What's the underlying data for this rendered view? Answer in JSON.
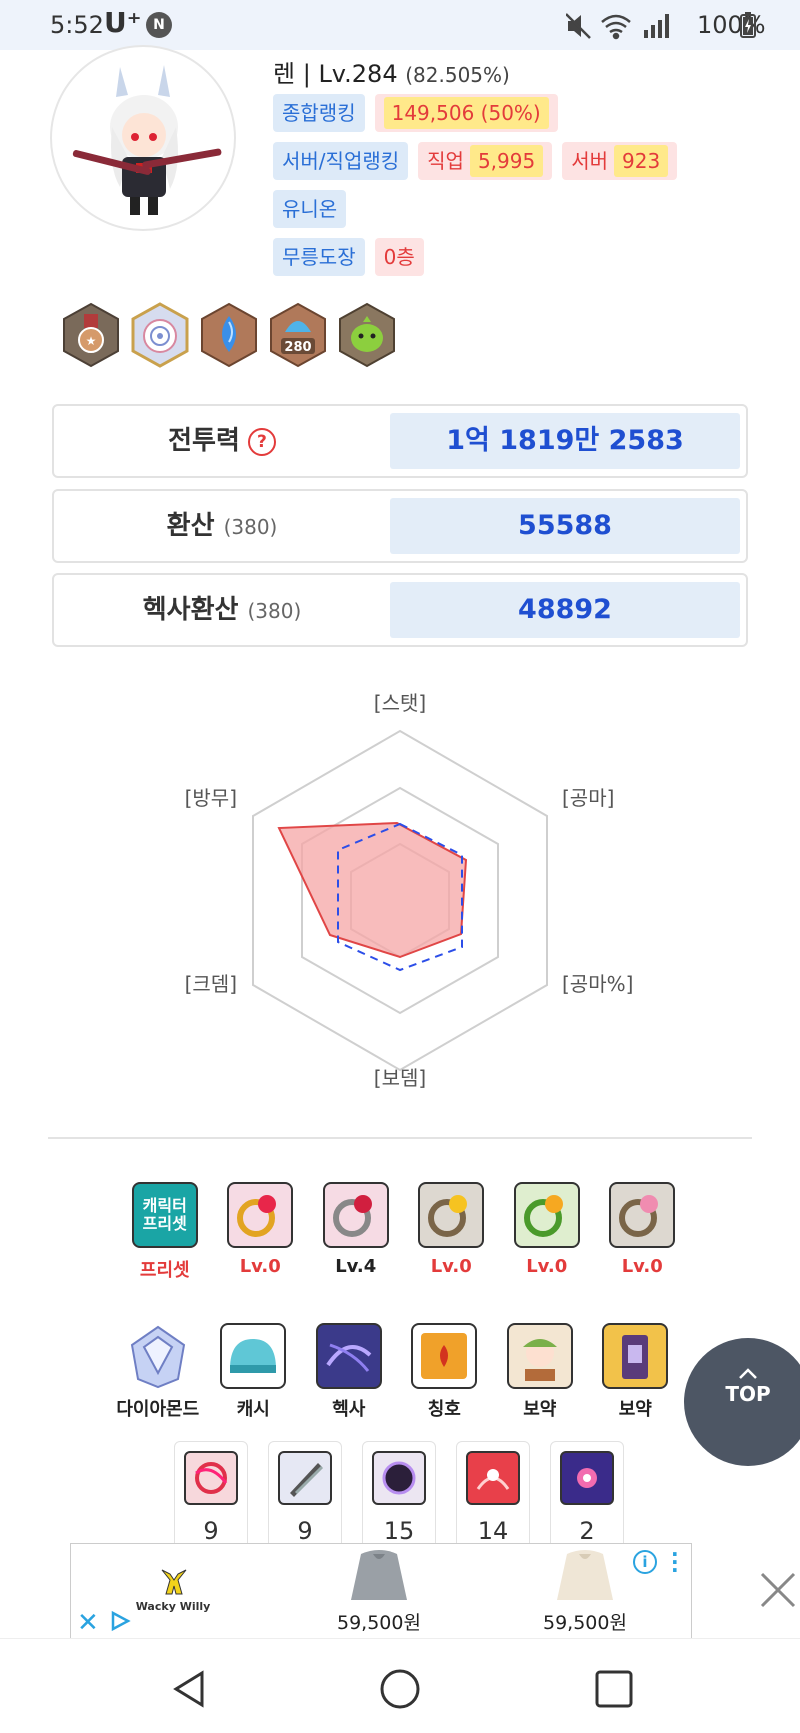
{
  "status_bar": {
    "time": "5:52",
    "carrier": "U⁺",
    "notif_badge": "N",
    "battery": "100%",
    "icons": [
      "mute-icon",
      "wifi-icon",
      "signal-icon",
      "battery-icon"
    ]
  },
  "profile": {
    "name": "렌",
    "separator": " | ",
    "level": "Lv.284",
    "exp": "(82.505%)",
    "overall_rank_label": "종합랭킹",
    "overall_rank_value": "149,506 (50%)",
    "server_job_rank_label": "서버/직업랭킹",
    "job_label": "직업",
    "job_value": "5,995",
    "server_label": "서버",
    "server_value": "923",
    "union_label": "유니온",
    "dojo_label": "무릉도장",
    "dojo_value": "0층"
  },
  "badges": [
    {
      "name": "bronze-medal-badge"
    },
    {
      "name": "target-badge"
    },
    {
      "name": "blue-gem-badge"
    },
    {
      "name": "280-badge",
      "text": "280"
    },
    {
      "name": "green-slime-badge"
    }
  ],
  "power": {
    "combat_label": "전투력",
    "combat_help": "?",
    "combat_value": "1억 1819만 2583",
    "conv_label": "환산",
    "conv_sub": "(380)",
    "conv_value": "55588",
    "hexa_label": "헥사환산",
    "hexa_sub": "(380)",
    "hexa_value": "48892"
  },
  "radar": {
    "axes": [
      "[스탯]",
      "[공마]",
      "[공마%]",
      "[보뎀]",
      "[크뎀]",
      "[방무]"
    ],
    "fill_color": "#f5a6a6",
    "line_color": "#e04646",
    "dash_color": "#2c4ee8"
  },
  "equip_row": [
    {
      "name": "character-preset",
      "label": "프리셋",
      "icon_text": "캐릭터 프리셋",
      "red": true
    },
    {
      "name": "ring-1",
      "label": "Lv.0",
      "red": true
    },
    {
      "name": "ring-2",
      "label": "Lv.4",
      "red": false
    },
    {
      "name": "ring-3",
      "label": "Lv.0",
      "red": true
    },
    {
      "name": "ring-4",
      "label": "Lv.0",
      "red": true
    },
    {
      "name": "ring-5",
      "label": "Lv.0",
      "red": true
    }
  ],
  "category_row": [
    {
      "name": "diamond",
      "label": "다이아몬드"
    },
    {
      "name": "cash",
      "label": "캐시"
    },
    {
      "name": "hexa",
      "label": "헥사"
    },
    {
      "name": "title",
      "label": "칭호"
    },
    {
      "name": "potion-1",
      "label": "보약"
    },
    {
      "name": "potion-2",
      "label": "보약"
    }
  ],
  "skill_cards": [
    {
      "name": "skill-1",
      "value": "9"
    },
    {
      "name": "skill-2",
      "value": "9"
    },
    {
      "name": "skill-3",
      "value": "15"
    },
    {
      "name": "skill-4",
      "value": "14"
    },
    {
      "name": "skill-5",
      "value": "2"
    }
  ],
  "top_button": "TOP",
  "ad": {
    "brand": "Wacky Willy",
    "price_1": "59,500원",
    "price_2": "59,500원"
  }
}
